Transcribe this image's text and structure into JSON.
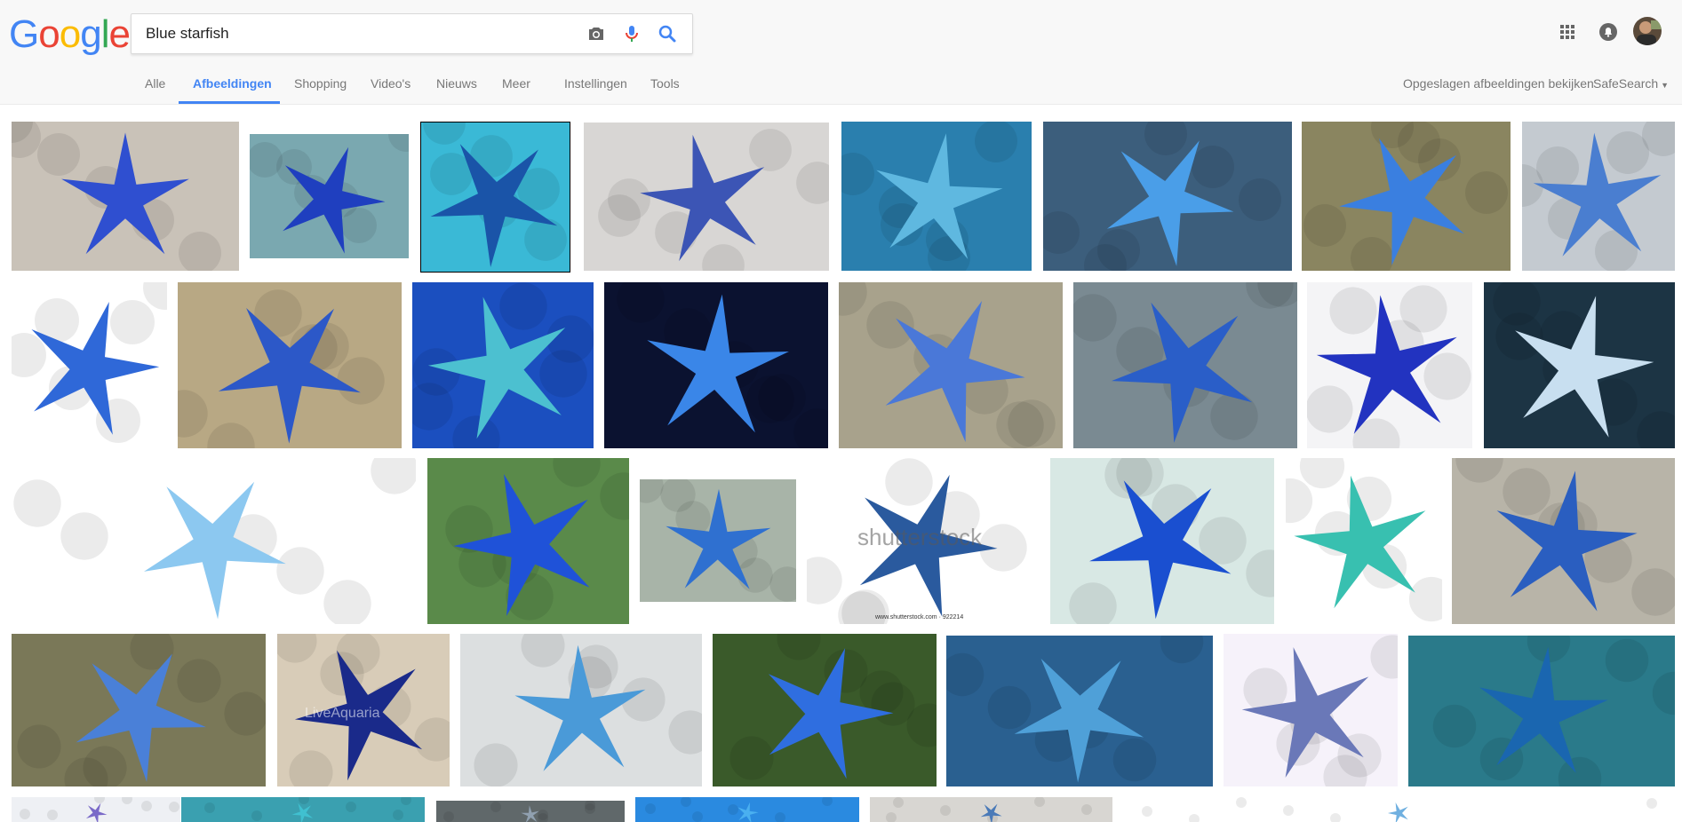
{
  "logo": {
    "text": "Google",
    "letters": [
      "G",
      "o",
      "o",
      "g",
      "l",
      "e"
    ],
    "colors": [
      "#4285f4",
      "#ea4335",
      "#fbbc05",
      "#4285f4",
      "#34a853",
      "#ea4335"
    ]
  },
  "search": {
    "query": "Blue starfish"
  },
  "icons": {
    "camera": "camera-icon",
    "mic": "microphone-icon",
    "search": "search-icon",
    "apps": "apps-grid-icon",
    "notifications": "bell-icon",
    "account": "avatar"
  },
  "tabs": [
    {
      "label": "Alle",
      "active": false
    },
    {
      "label": "Afbeeldingen",
      "active": true
    },
    {
      "label": "Shopping",
      "active": false
    },
    {
      "label": "Video's",
      "active": false
    },
    {
      "label": "Nieuws",
      "active": false
    },
    {
      "label": "Meer",
      "active": false
    },
    {
      "label": "Instellingen",
      "active": false
    },
    {
      "label": "Tools",
      "active": false
    }
  ],
  "right_links": {
    "saved": "Opgeslagen afbeeldingen bekijken",
    "safesearch": "SafeSearch"
  },
  "watermarks": {
    "shutterstock": "shutterstock",
    "shutterstock_small": "www.shutterstock.com · 922214",
    "liveaquaria": "LiveAquaria"
  },
  "colors": {
    "accent": "#4285f4",
    "tab_text": "#777777",
    "header_bg": "#f8f8f8"
  }
}
